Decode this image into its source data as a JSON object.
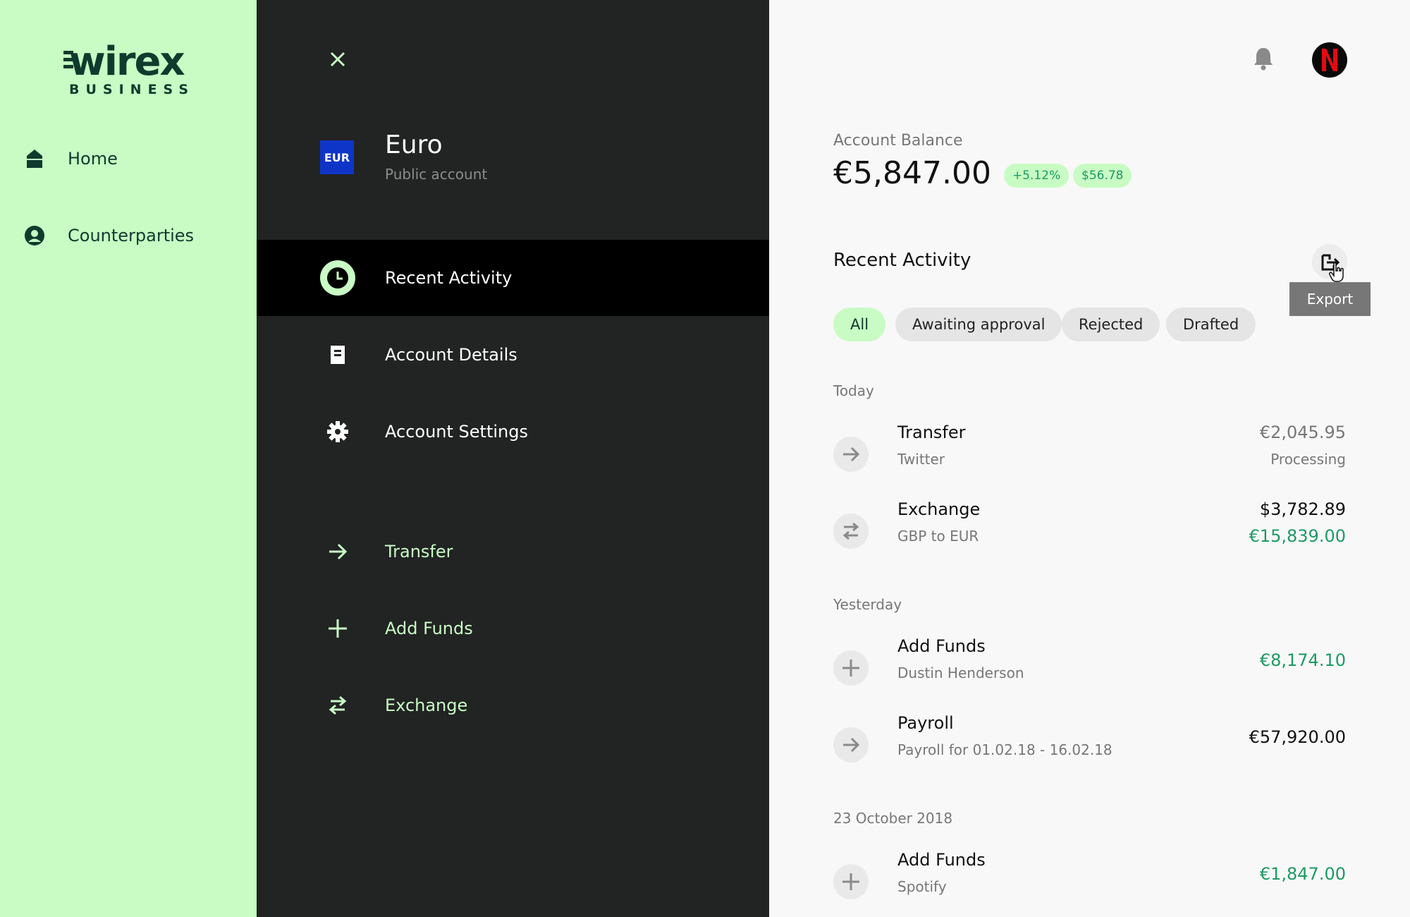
{
  "brand": {
    "wordmark": "wirex",
    "submark": "BUSINESS"
  },
  "sidebar": {
    "items": [
      {
        "label": "Home",
        "icon": "home-icon"
      },
      {
        "label": "Counterparties",
        "icon": "user-circle-icon"
      }
    ]
  },
  "account_panel": {
    "currency_code": "EUR",
    "name": "Euro",
    "type": "Public account",
    "menu": [
      {
        "label": "Recent Activity",
        "icon": "clock-icon",
        "active": true
      },
      {
        "label": "Account Details",
        "icon": "document-icon"
      },
      {
        "label": "Account Settings",
        "icon": "gear-icon"
      }
    ],
    "actions": [
      {
        "label": "Transfer",
        "icon": "arrow-right-icon"
      },
      {
        "label": "Add Funds",
        "icon": "plus-icon"
      },
      {
        "label": "Exchange",
        "icon": "exchange-icon"
      }
    ]
  },
  "main": {
    "balance_label": "Account Balance",
    "balance_value": "€5,847.00",
    "chips": [
      "+5.12%",
      "$56.78"
    ],
    "section_title": "Recent Activity",
    "export_tooltip": "Export",
    "filters": [
      "All",
      "Awaiting approval",
      "Rejected",
      "Drafted"
    ],
    "groups": [
      {
        "label": "Today",
        "items": [
          {
            "title": "Transfer",
            "subtitle": "Twitter",
            "amount": "€2,045.95",
            "amount2": "Processing",
            "icon": "arrow-right-icon"
          },
          {
            "title": "Exchange",
            "subtitle": "GBP to EUR",
            "amount": "$3,782.89",
            "amount2": "€15,839.00",
            "icon": "exchange-icon"
          }
        ]
      },
      {
        "label": "Yesterday",
        "items": [
          {
            "title": "Add Funds",
            "subtitle": "Dustin Henderson",
            "amount": "€8,174.10",
            "icon": "plus-icon"
          },
          {
            "title": "Payroll",
            "subtitle": "Payroll for 01.02.18 - 16.02.18",
            "amount": "€57,920.00",
            "icon": "arrow-right-icon"
          }
        ]
      },
      {
        "label": "23 October 2018",
        "items": [
          {
            "title": "Add Funds",
            "subtitle": "Spotify",
            "amount": "€1,847.00",
            "icon": "plus-icon"
          }
        ]
      }
    ]
  },
  "colors": {
    "sidebar_bg": "#c8fcc4",
    "panel_bg": "#222323",
    "accent_green": "#1d9a64",
    "eur_blue": "#0f35c8"
  }
}
